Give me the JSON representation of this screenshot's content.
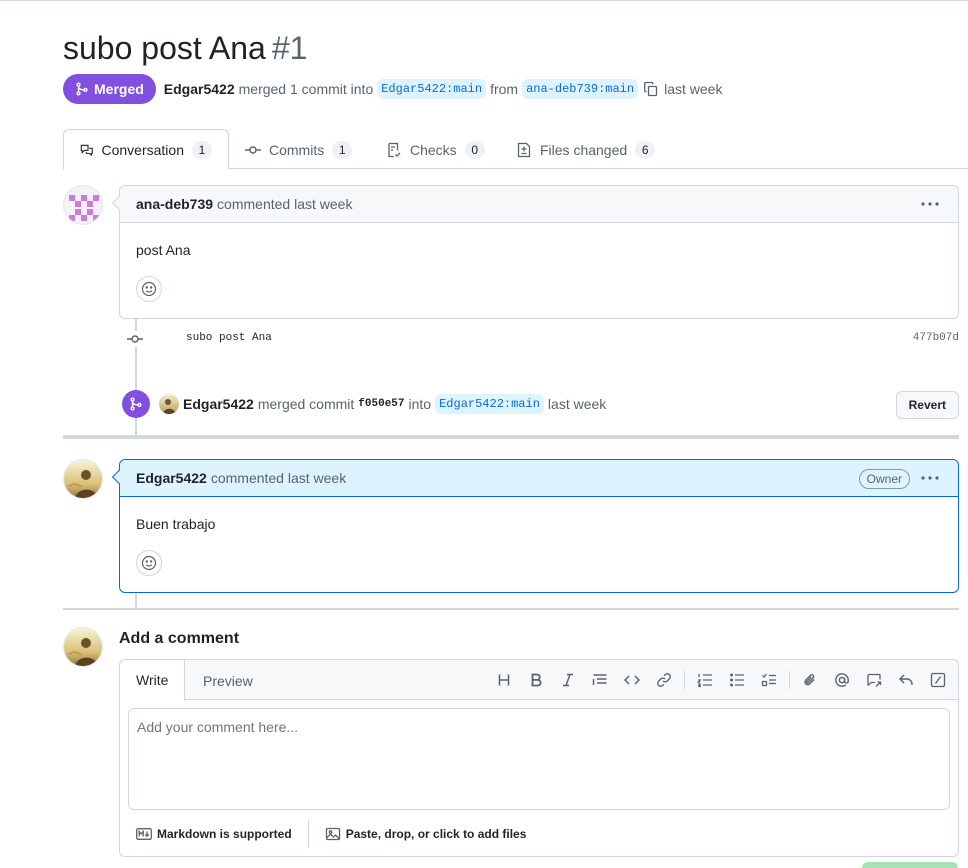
{
  "pull_request": {
    "title": "subo post Ana",
    "number": "#1",
    "state": "Merged",
    "author": "Edgar5422",
    "merge_text": "merged 1 commit into",
    "base_branch": "Edgar5422:main",
    "from_text": "from",
    "head_branch": "ana-deb739:main",
    "when": "last week"
  },
  "tabs": [
    {
      "label": "Conversation",
      "count": "1"
    },
    {
      "label": "Commits",
      "count": "1"
    },
    {
      "label": "Checks",
      "count": "0"
    },
    {
      "label": "Files changed",
      "count": "6"
    }
  ],
  "comment1": {
    "author": "ana-deb739",
    "action": "commented last week",
    "body": "post Ana"
  },
  "commit": {
    "message": "subo post Ana",
    "sha": "477b07d"
  },
  "merge_event": {
    "author": "Edgar5422",
    "text": "merged commit",
    "sha": "f050e57",
    "into": "into",
    "branch": "Edgar5422:main",
    "when": "last week",
    "revert_label": "Revert"
  },
  "comment2": {
    "author": "Edgar5422",
    "action": "commented last week",
    "badge": "Owner",
    "body": "Buen trabajo"
  },
  "new_comment": {
    "title": "Add a comment",
    "write_tab": "Write",
    "preview_tab": "Preview",
    "placeholder": "Add your comment here...",
    "markdown_note": "Markdown is supported",
    "attach_note": "Paste, drop, or click to add files"
  },
  "colors": {
    "merged": "#8250df",
    "link": "#0969da",
    "border": "#d0d7de"
  }
}
